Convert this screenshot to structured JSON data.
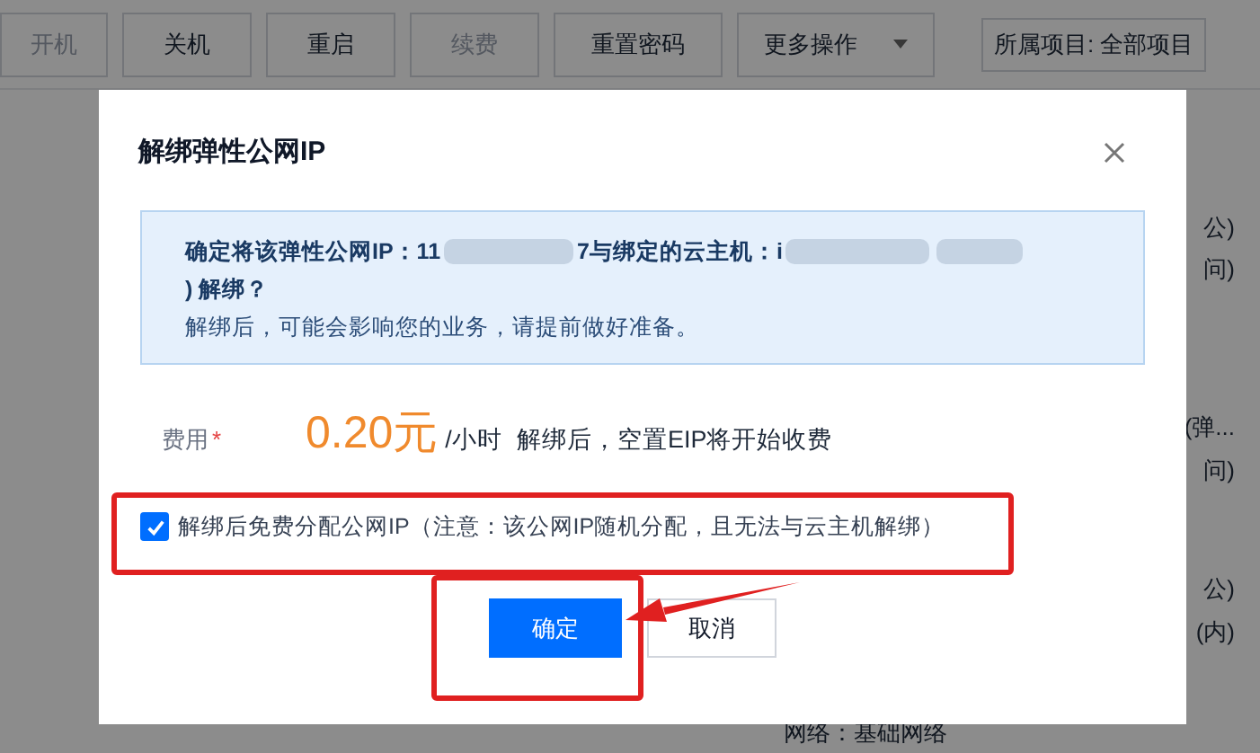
{
  "toolbar": [
    {
      "label": "开机",
      "disabled": true
    },
    {
      "label": "关机",
      "disabled": false
    },
    {
      "label": "重启",
      "disabled": false
    },
    {
      "label": "续费",
      "disabled": true
    },
    {
      "label": "重置密码",
      "disabled": false
    },
    {
      "label": "更多操作",
      "disabled": false,
      "kind": "dropdown"
    }
  ],
  "project_filter": "所属项目: 全部项目",
  "background_cells": [
    "公)",
    "问)",
    "(弹...",
    "问)",
    "公)",
    "(内)",
    "网络：基础网络"
  ],
  "dialog": {
    "title": "解绑弹性公网IP",
    "notice": {
      "segments": [
        {
          "kind": "text",
          "text": "确定将该弹性公网IP：11"
        },
        {
          "kind": "blur"
        },
        {
          "kind": "text",
          "text": "7与绑定的云主机：i"
        },
        {
          "kind": "blur"
        },
        {
          "kind": "blur"
        },
        {
          "kind": "text",
          "text": ") 解绑？"
        }
      ],
      "detail": "解绑后，可能会影响您的业务，请提前做好准备。"
    },
    "fee": {
      "label": "费用",
      "required_mark": "*",
      "price": "0.20元",
      "unit": "/小时",
      "note": "解绑后，空置EIP将开始收费"
    },
    "option": {
      "label": "解绑后免费分配公网IP（注意：该公网IP随机分配，且无法与云主机解绑）",
      "checked": true
    },
    "buttons": [
      {
        "label": "确定",
        "kind": "primary"
      },
      {
        "label": "取消",
        "kind": "secondary"
      }
    ]
  }
}
